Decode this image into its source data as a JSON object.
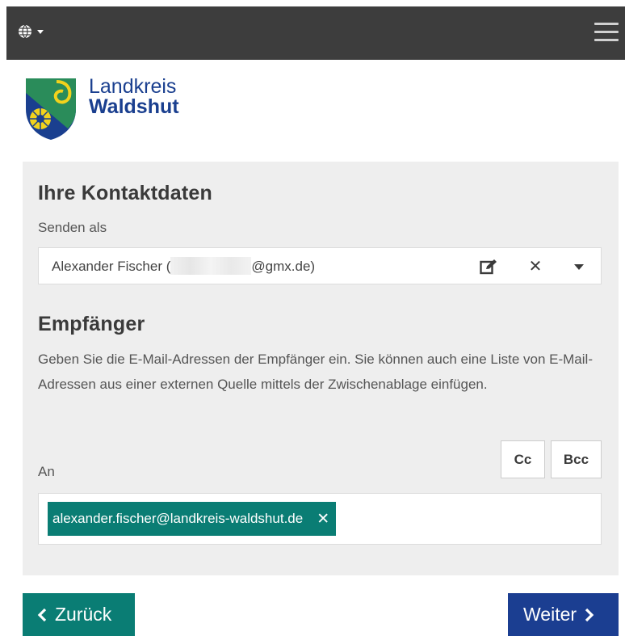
{
  "header": {
    "language_icon": "globe-icon",
    "menu_icon": "hamburger-menu-icon"
  },
  "logo": {
    "line1": "Landkreis",
    "line2": "Waldshut",
    "emblem": "coat-of-arms"
  },
  "contact": {
    "title": "Ihre Kontaktdaten",
    "send_as_label": "Senden als",
    "sender_name_prefix": "Alexander Fischer (",
    "sender_email_suffix": "@gmx.de)",
    "icons": [
      "edit-icon",
      "close-icon",
      "chevron-down-icon"
    ]
  },
  "recipients": {
    "title": "Empfänger",
    "description": "Geben Sie die E-Mail-Adressen der Empfänger ein. Sie können auch eine Liste von E-Mail-Adressen aus einer externen Quelle mittels der Zwischenablage einfügen.",
    "to_label": "An",
    "cc_label": "Cc",
    "bcc_label": "Bcc",
    "chips": [
      {
        "email": "alexander.fischer@landkreis-waldshut.de"
      }
    ]
  },
  "nav": {
    "back_label": "Zurück",
    "next_label": "Weiter"
  },
  "colors": {
    "teal": "#0a7d74",
    "navy": "#1b3e91",
    "topbar": "#3d3d3d",
    "panel": "#eeeeee"
  }
}
